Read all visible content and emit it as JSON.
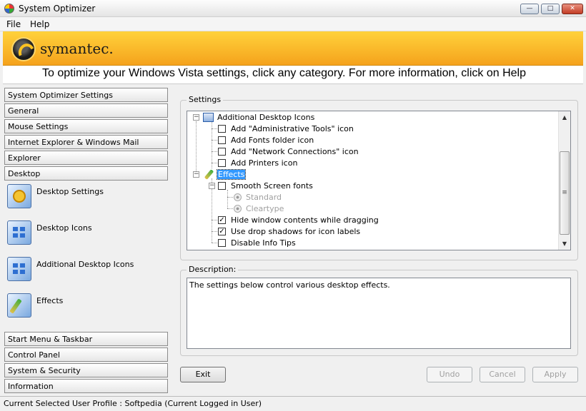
{
  "window": {
    "title": "System Optimizer"
  },
  "menu": [
    "File",
    "Help"
  ],
  "banner": {
    "brand": "symantec."
  },
  "instruction": "To optimize your Windows Vista settings, click any category. For more information, click on Help",
  "sidebar": {
    "categories_top": [
      "System Optimizer Settings",
      "General",
      "Mouse Settings",
      "Internet Explorer & Windows Mail",
      "Explorer",
      "Desktop"
    ],
    "subitems": [
      {
        "label": "Desktop Settings",
        "icon": "desktop-settings-icon"
      },
      {
        "label": "Desktop Icons",
        "icon": "desktop-icons-icon"
      },
      {
        "label": "Additional Desktop Icons",
        "icon": "additional-desktop-icons-icon"
      },
      {
        "label": "Effects",
        "icon": "effects-icon"
      }
    ],
    "categories_bottom": [
      "Start Menu & Taskbar",
      "Control Panel",
      "System & Security",
      "Information"
    ]
  },
  "settings": {
    "label": "Settings",
    "tree": [
      {
        "label": "Additional Desktop Icons",
        "type": "group"
      },
      {
        "label": "Add \"Administrative Tools\" icon",
        "type": "checkbox",
        "checked": false
      },
      {
        "label": "Add Fonts folder icon",
        "type": "checkbox",
        "checked": false
      },
      {
        "label": "Add \"Network Connections\" icon",
        "type": "checkbox",
        "checked": false
      },
      {
        "label": "Add Printers icon",
        "type": "checkbox",
        "checked": false
      },
      {
        "label": "Effects",
        "type": "group",
        "selected": true
      },
      {
        "label": "Smooth Screen fonts",
        "type": "checkbox",
        "checked": false
      },
      {
        "label": "Standard",
        "type": "radio",
        "disabled": true
      },
      {
        "label": "Cleartype",
        "type": "radio",
        "disabled": true
      },
      {
        "label": "Hide window contents while dragging",
        "type": "checkbox",
        "checked": true
      },
      {
        "label": "Use drop shadows for icon labels",
        "type": "checkbox",
        "checked": true
      },
      {
        "label": "Disable Info Tips",
        "type": "checkbox",
        "checked": false
      }
    ]
  },
  "description": {
    "label": "Description:",
    "text": "The settings below control various desktop effects."
  },
  "buttons": {
    "exit": "Exit",
    "undo": "Undo",
    "cancel": "Cancel",
    "apply": "Apply"
  },
  "status": "Current Selected User Profile :  Softpedia (Current Logged in User)",
  "glyphs": {
    "minimize": "—",
    "maximize": "□",
    "close": "✕",
    "check": "✓",
    "collapse": "−",
    "scroll_up": "▲",
    "scroll_down": "▼",
    "grip": "≡"
  }
}
